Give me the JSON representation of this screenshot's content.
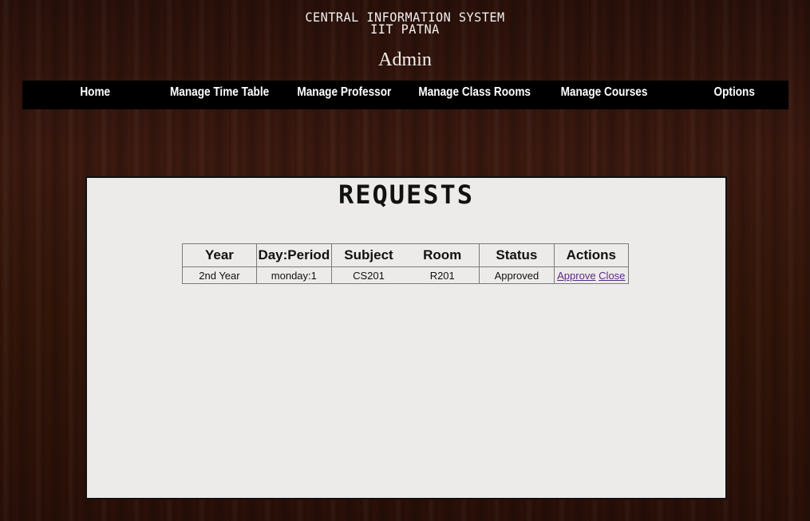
{
  "header": {
    "title_line1": "CENTRAL INFORMATION SYSTEM",
    "title_line2": "IIT PATNA",
    "role": "Admin"
  },
  "nav": {
    "items": [
      {
        "label": "Home"
      },
      {
        "label": "Manage Time Table"
      },
      {
        "label": "Manage Professor"
      },
      {
        "label": "Manage Class Rooms"
      },
      {
        "label": "Manage Courses"
      },
      {
        "label": "Options"
      }
    ]
  },
  "panel": {
    "title": "REQUESTS",
    "table": {
      "columns": [
        "Year",
        "Day:Period",
        "Subject",
        "Room",
        "Status",
        "Actions"
      ],
      "rows": [
        {
          "year": "2nd Year",
          "day_period": "monday:1",
          "subject": "CS201",
          "room": "R201",
          "status": "Approved",
          "actions": [
            "Approve",
            "Close"
          ]
        }
      ]
    }
  }
}
